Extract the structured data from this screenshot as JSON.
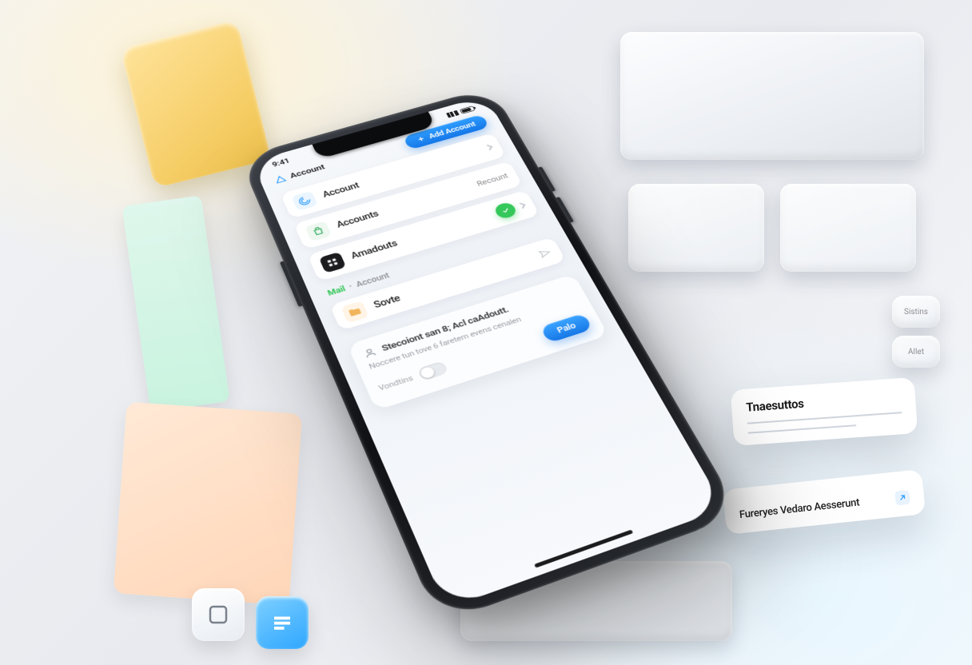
{
  "status": {
    "time": "9:41"
  },
  "header": {
    "label": "Account",
    "pill": "Add Account"
  },
  "rows": [
    {
      "label": "Account",
      "trailing": ""
    },
    {
      "label": "Accounts",
      "trailing": "Recount"
    },
    {
      "label": "Amadouts",
      "trailing": ""
    }
  ],
  "section": {
    "tag": "Mail",
    "sub": "Account"
  },
  "secondary": [
    {
      "label": "Sovte"
    }
  ],
  "bottom": {
    "heading": "Stecoiont san 8; Acl caAdoutt.",
    "sub": "Noccere tun tove 6 faretem evens cenalen",
    "mini": "Vondtins",
    "cta": "Palo"
  },
  "cards": {
    "transfers": {
      "title": "Tnaesuttos",
      "line1": "",
      "line2": ""
    },
    "reserve": {
      "title": "Fureryes Vedaro Aesserunt"
    },
    "side1": {
      "label": "Sistins"
    },
    "side2": {
      "label": "Allet"
    }
  }
}
